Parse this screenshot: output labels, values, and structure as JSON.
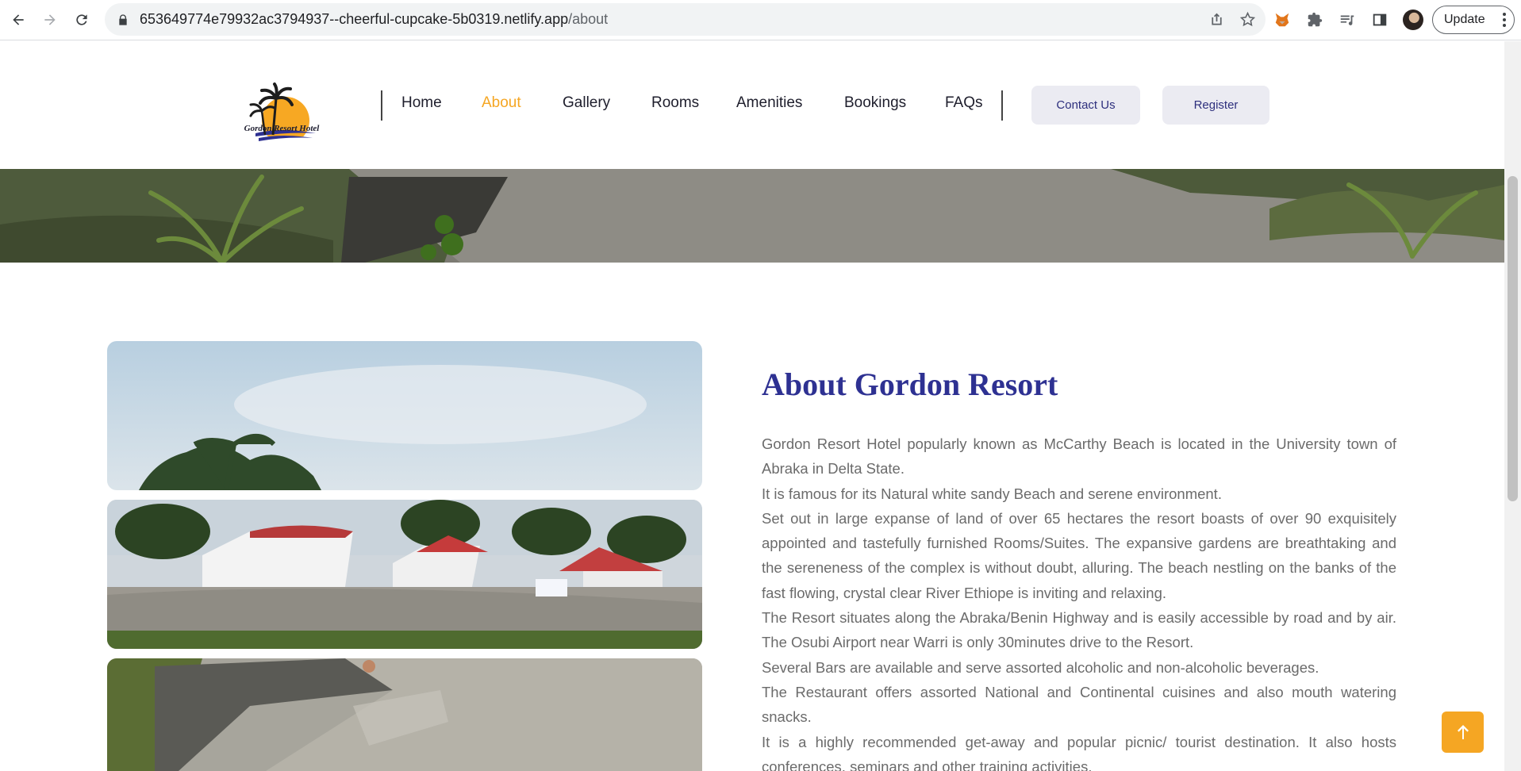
{
  "browser": {
    "url_host": "653649774e79932ac3794937--cheerful-cupcake-5b0319.netlify.app",
    "url_path": "/about",
    "update_label": "Update"
  },
  "site": {
    "logo_text": "Gordon Resort Hotel",
    "nav": [
      {
        "label": "Home",
        "active": false
      },
      {
        "label": "About",
        "active": true
      },
      {
        "label": "Gallery",
        "active": false
      },
      {
        "label": "Rooms",
        "active": false
      },
      {
        "label": "Amenities",
        "active": false
      },
      {
        "label": "Bookings",
        "active": false
      },
      {
        "label": "FAQs",
        "active": false
      }
    ],
    "contact_label": "Contact Us",
    "register_label": "Register",
    "accent_color": "#f5a623",
    "heading_color": "#2e3192"
  },
  "about": {
    "title": "About Gordon Resort",
    "paragraphs": [
      "Gordon Resort Hotel popularly known as McCarthy Beach is located in the University town of Abraka in Delta State.",
      "It is famous for its Natural white sandy Beach and serene environment.",
      "Set out in large expanse of land of over 65 hectares the resort boasts of over 90 exquisitely appointed and tastefully furnished Rooms/Suites. The expansive gardens are breathtaking and the sereneness of the complex is without doubt, alluring. The beach nestling on the banks of the fast flowing, crystal clear River Ethiope is inviting and relaxing.",
      "The Resort situates along the Abraka/Benin Highway and is easily accessible by road and by air. The Osubi Airport near Warri is only 30minutes drive to the Resort.",
      "Several Bars are available and serve assorted alcoholic and non-alcoholic beverages.",
      "The Restaurant offers assorted National and Continental cuisines and also mouth watering snacks.",
      "It is a highly recommended get-away and popular picnic/ tourist destination. It also hosts conferences, seminars and other training activities."
    ]
  }
}
